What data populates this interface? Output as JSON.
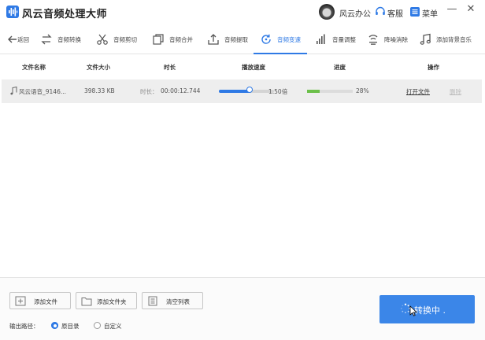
{
  "app": {
    "title": "风云音频处理大师",
    "brand": "风云办公",
    "service": "客服",
    "menu": "菜单",
    "minimize": "—",
    "close": "✕"
  },
  "toolbar": {
    "back": "返回",
    "items": [
      {
        "label": "音频转换",
        "icon": "convert-arrows-icon"
      },
      {
        "label": "音频剪切",
        "icon": "scissors-icon"
      },
      {
        "label": "音频合并",
        "icon": "merge-icon"
      },
      {
        "label": "音频提取",
        "icon": "extract-upload-icon"
      },
      {
        "label": "音频变速",
        "icon": "speed-refresh-icon",
        "active": true
      },
      {
        "label": "音量调整",
        "icon": "volume-bars-icon"
      },
      {
        "label": "降噪消除",
        "icon": "noise-wave-icon"
      },
      {
        "label": "添加背景音乐",
        "icon": "music-note-icon"
      }
    ]
  },
  "table": {
    "headers": {
      "name": "文件名称",
      "size": "文件大小",
      "duration": "时长",
      "speed": "播放速度",
      "progress": "进度",
      "actions": "操作"
    },
    "rows": [
      {
        "name": "风云语音_9146...",
        "size": "398.33 KB",
        "duration_label": "时长：",
        "duration": "00:00:12.744",
        "speed_fraction": 0.55,
        "speed_text": "1.50倍",
        "progress": 28,
        "progress_text": "28%",
        "open": "打开文件",
        "delete": "删除"
      }
    ]
  },
  "footer": {
    "add_file": "添加文件",
    "add_folder": "添加文件夹",
    "clear_list": "清空列表",
    "output_label": "输出路径：",
    "option_original": "原目录",
    "option_custom": "自定义",
    "convert": "转换中 ."
  },
  "colors": {
    "accent": "#2f7ae5",
    "progress": "#6cc04a",
    "button": "#3b86e8"
  }
}
